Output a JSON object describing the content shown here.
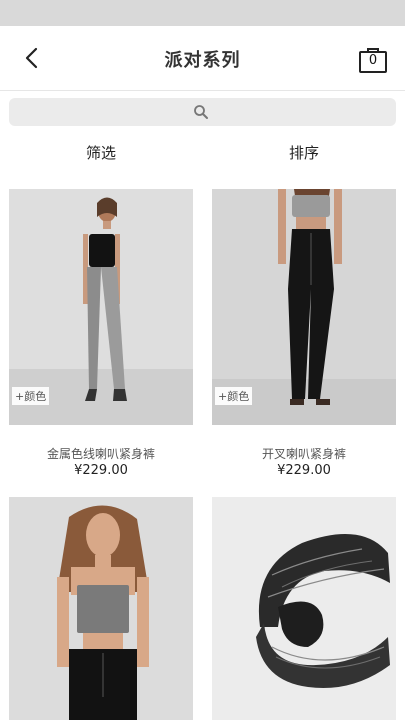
{
  "header": {
    "title": "派对系列",
    "bag_count": "0"
  },
  "toolbar": {
    "filter_label": "筛选",
    "sort_label": "排序"
  },
  "products": [
    {
      "name": "金属色线喇叭紧身裤",
      "price": "¥229.00",
      "color_tag": "+颜色"
    },
    {
      "name": "开叉喇叭紧身裤",
      "price": "¥229.00",
      "color_tag": "+颜色"
    },
    {
      "name": "",
      "price": ""
    },
    {
      "name": "",
      "price": ""
    }
  ],
  "icons": {
    "back": "chevron-left-icon",
    "bag": "shopping-bag-icon",
    "search": "search-icon"
  }
}
